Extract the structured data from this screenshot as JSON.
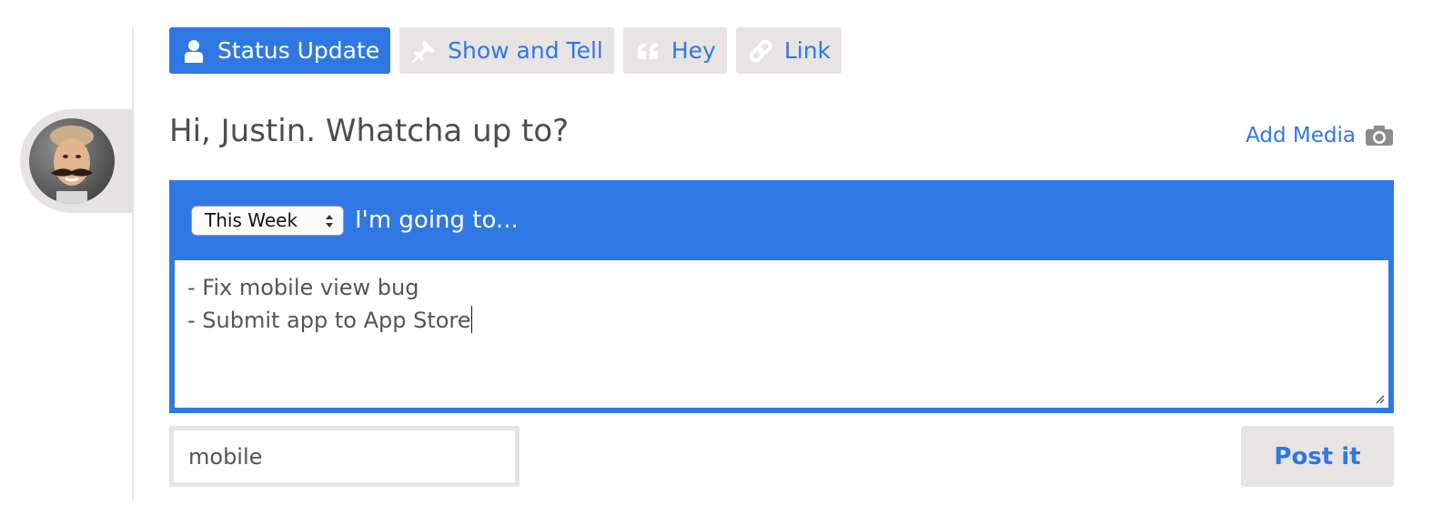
{
  "tabs": [
    {
      "label": "Status Update",
      "icon": "person-icon",
      "active": true
    },
    {
      "label": "Show and Tell",
      "icon": "pushpin-icon",
      "active": false
    },
    {
      "label": "Hey",
      "icon": "quote-icon",
      "active": false
    },
    {
      "label": "Link",
      "icon": "link-icon",
      "active": false
    }
  ],
  "greeting": "Hi, Justin. Whatcha up to?",
  "add_media": {
    "label": "Add Media",
    "icon": "camera-icon"
  },
  "composer": {
    "timeframe_selected": "This Week",
    "lead_text": "I'm going to...",
    "lines": [
      "- Fix mobile view bug",
      "- Submit app to App Store"
    ]
  },
  "tags_input": {
    "value": "mobile"
  },
  "post_button": {
    "label": "Post it"
  },
  "colors": {
    "accent": "#2f78e4",
    "tab_bg": "#e8e4e4",
    "text": "#4d4d4d"
  }
}
